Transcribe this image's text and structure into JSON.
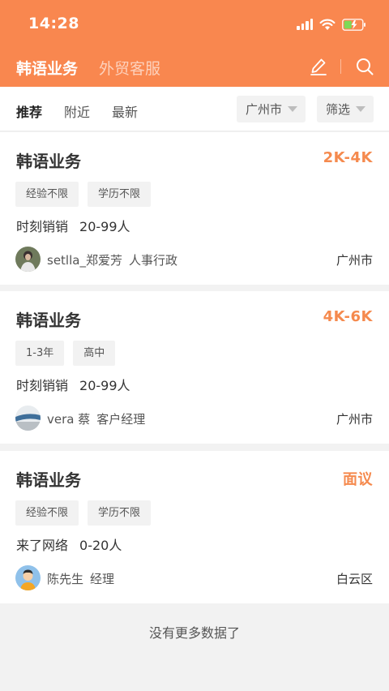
{
  "status": {
    "time": "14:28"
  },
  "header": {
    "tabs": [
      {
        "label": "韩语业务",
        "active": true
      },
      {
        "label": "外贸客服",
        "active": false
      }
    ],
    "accent_color": "#f9874f"
  },
  "filter": {
    "tabs": [
      {
        "label": "推荐",
        "active": true
      },
      {
        "label": "附近",
        "active": false
      },
      {
        "label": "最新",
        "active": false
      }
    ],
    "city": "广州市",
    "filter_label": "筛选"
  },
  "jobs": [
    {
      "title": "韩语业务",
      "salary": "2K-4K",
      "tags": [
        "经验不限",
        "学历不限"
      ],
      "company": "时刻销销",
      "size": "20-99人",
      "recruiter": "setlla_郑爱芳",
      "role": "人事行政",
      "location": "广州市",
      "avatar_icon": "person-photo-avatar"
    },
    {
      "title": "韩语业务",
      "salary": "4K-6K",
      "tags": [
        "1-3年",
        "高中"
      ],
      "company": "时刻销销",
      "size": "20-99人",
      "recruiter": "vera 蔡",
      "role": "客户经理",
      "location": "广州市",
      "avatar_icon": "landscape-photo-avatar"
    },
    {
      "title": "韩语业务",
      "salary": "面议",
      "tags": [
        "经验不限",
        "学历不限"
      ],
      "company": "来了网络",
      "size": "0-20人",
      "recruiter": "陈先生",
      "role": "经理",
      "location": "白云区",
      "avatar_icon": "cartoon-man-avatar"
    }
  ],
  "footer": {
    "no_more": "没有更多数据了"
  }
}
